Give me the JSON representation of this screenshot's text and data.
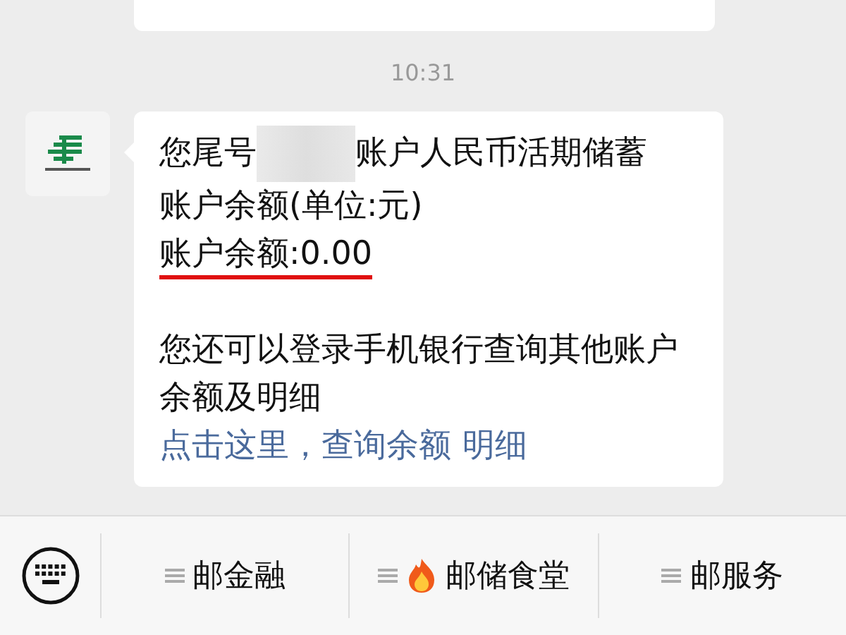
{
  "timestamp": "10:31",
  "message": {
    "lines": [
      {
        "kind": "masked",
        "before": "您尾号",
        "after": "账户人民币活期储蓄"
      },
      {
        "kind": "plain",
        "text": "账户余额(单位:元)"
      },
      {
        "kind": "underlined",
        "text": "账户余额:0.00"
      },
      {
        "kind": "blank"
      },
      {
        "kind": "plain",
        "text": "您还可以登录手机银行查询其他账户余额及明细"
      }
    ],
    "links": [
      "点击这里，查询余额",
      "明细"
    ]
  },
  "menu": [
    {
      "label": "邮金融",
      "hot": false
    },
    {
      "label": "邮储食堂",
      "hot": true
    },
    {
      "label": "邮服务",
      "hot": false
    }
  ]
}
